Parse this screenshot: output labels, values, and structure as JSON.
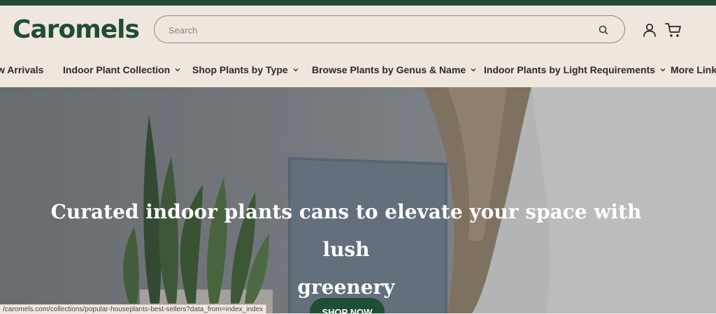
{
  "brand": {
    "logo_text": "Caromels",
    "primary_color": "#1f4d36"
  },
  "search": {
    "placeholder": "Search"
  },
  "header_icons": {
    "search": "search-icon",
    "account": "account-icon",
    "cart": "cart-icon"
  },
  "nav": {
    "items": [
      {
        "label": "w Arrivals",
        "has_dropdown": false
      },
      {
        "label": "Indoor Plant Collection",
        "has_dropdown": true
      },
      {
        "label": "Shop Plants by Type",
        "has_dropdown": true
      },
      {
        "label": "Browse Plants by Genus & Name",
        "has_dropdown": true
      },
      {
        "label": "Indoor Plants by Light Requirements",
        "has_dropdown": true
      },
      {
        "label": "More Links",
        "has_dropdown": false
      }
    ]
  },
  "hero": {
    "title_line1": "Curated indoor plants cans to elevate your space with lush",
    "title_line2": "greenery",
    "cta_label": "SHOP NOW"
  },
  "status_bar": {
    "url": "/caromels.com/collections/popular-houseplants-best-sellers?data_from=index_index"
  }
}
